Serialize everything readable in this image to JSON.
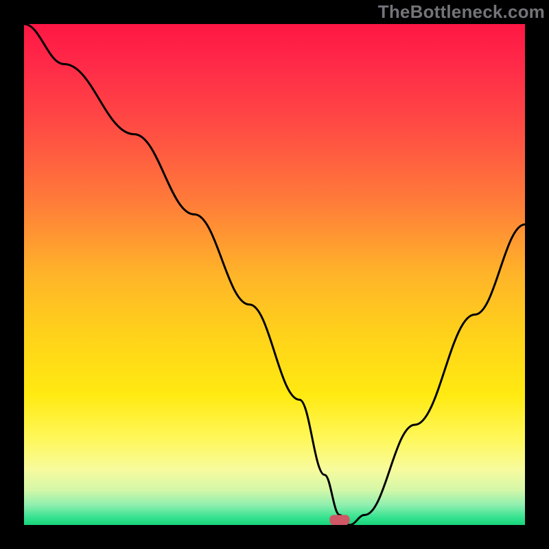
{
  "watermark": "TheBottleneck.com",
  "chart_data": {
    "type": "line",
    "title": "",
    "xlabel": "",
    "ylabel": "",
    "xlim": [
      0,
      100
    ],
    "ylim": [
      0,
      100
    ],
    "series": [
      {
        "name": "bottleneck-curve",
        "x": [
          0,
          8,
          22,
          34,
          45,
          55,
          60,
          63,
          65,
          68,
          78,
          90,
          100
        ],
        "values": [
          100,
          92,
          78,
          62,
          44,
          25,
          10,
          2,
          0,
          2,
          20,
          42,
          60
        ]
      }
    ],
    "marker": {
      "x": 63,
      "y": 0,
      "w": 4,
      "h": 2,
      "color": "#cf5766"
    },
    "gradient_stops": [
      {
        "offset": 0.0,
        "color": "#ff1744"
      },
      {
        "offset": 0.08,
        "color": "#ff2a48"
      },
      {
        "offset": 0.2,
        "color": "#ff4a44"
      },
      {
        "offset": 0.35,
        "color": "#ff7a3a"
      },
      {
        "offset": 0.5,
        "color": "#ffb429"
      },
      {
        "offset": 0.62,
        "color": "#ffd21a"
      },
      {
        "offset": 0.74,
        "color": "#ffea11"
      },
      {
        "offset": 0.83,
        "color": "#fff85c"
      },
      {
        "offset": 0.89,
        "color": "#f7fb9e"
      },
      {
        "offset": 0.93,
        "color": "#d4f7a8"
      },
      {
        "offset": 0.96,
        "color": "#8fefaf"
      },
      {
        "offset": 0.985,
        "color": "#35e28f"
      },
      {
        "offset": 1.0,
        "color": "#17d47a"
      }
    ]
  }
}
